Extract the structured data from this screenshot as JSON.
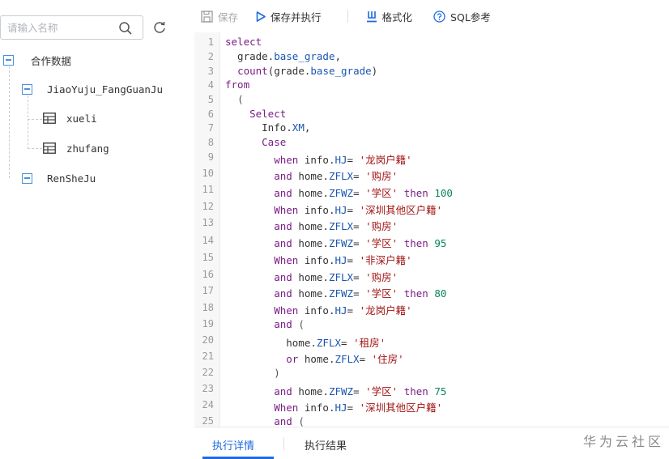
{
  "sidebar": {
    "search_placeholder": "请输入名称",
    "tree": {
      "root_label": "合作数据",
      "db1_label": "JiaoYuju_FangGuanJu",
      "table1_label": "xueli",
      "table2_label": "zhufang",
      "db2_label": "RenSheJu"
    }
  },
  "toolbar": {
    "save_label": "保存",
    "save_run_label": "保存并执行",
    "format_label": "格式化",
    "sql_ref_label": "SQL参考"
  },
  "editor": {
    "line_numbers": [
      "1",
      "2",
      "3",
      "4",
      "5",
      "6",
      "7",
      "8",
      "9",
      "10",
      "11",
      "12",
      "13",
      "14",
      "15",
      "16",
      "17",
      "18",
      "19",
      "20",
      "21",
      "22",
      "23",
      "24",
      "25"
    ]
  },
  "tabs": {
    "detail_label": "执行详情",
    "result_label": "执行结果"
  },
  "watermark": "华为云社区",
  "colors": {
    "accent": "#1e6be0",
    "tree_icon": "#4a90d9",
    "keyword": "#7a1d86",
    "string": "#a31515",
    "property": "#1a56b0",
    "number": "#098658"
  },
  "icons": {
    "save": "save-icon",
    "run": "play-icon",
    "format": "format-icon",
    "help": "help-circle-icon",
    "search": "search-icon",
    "refresh": "refresh-icon",
    "table": "table-icon",
    "collapse": "collapse-minus-icon"
  }
}
